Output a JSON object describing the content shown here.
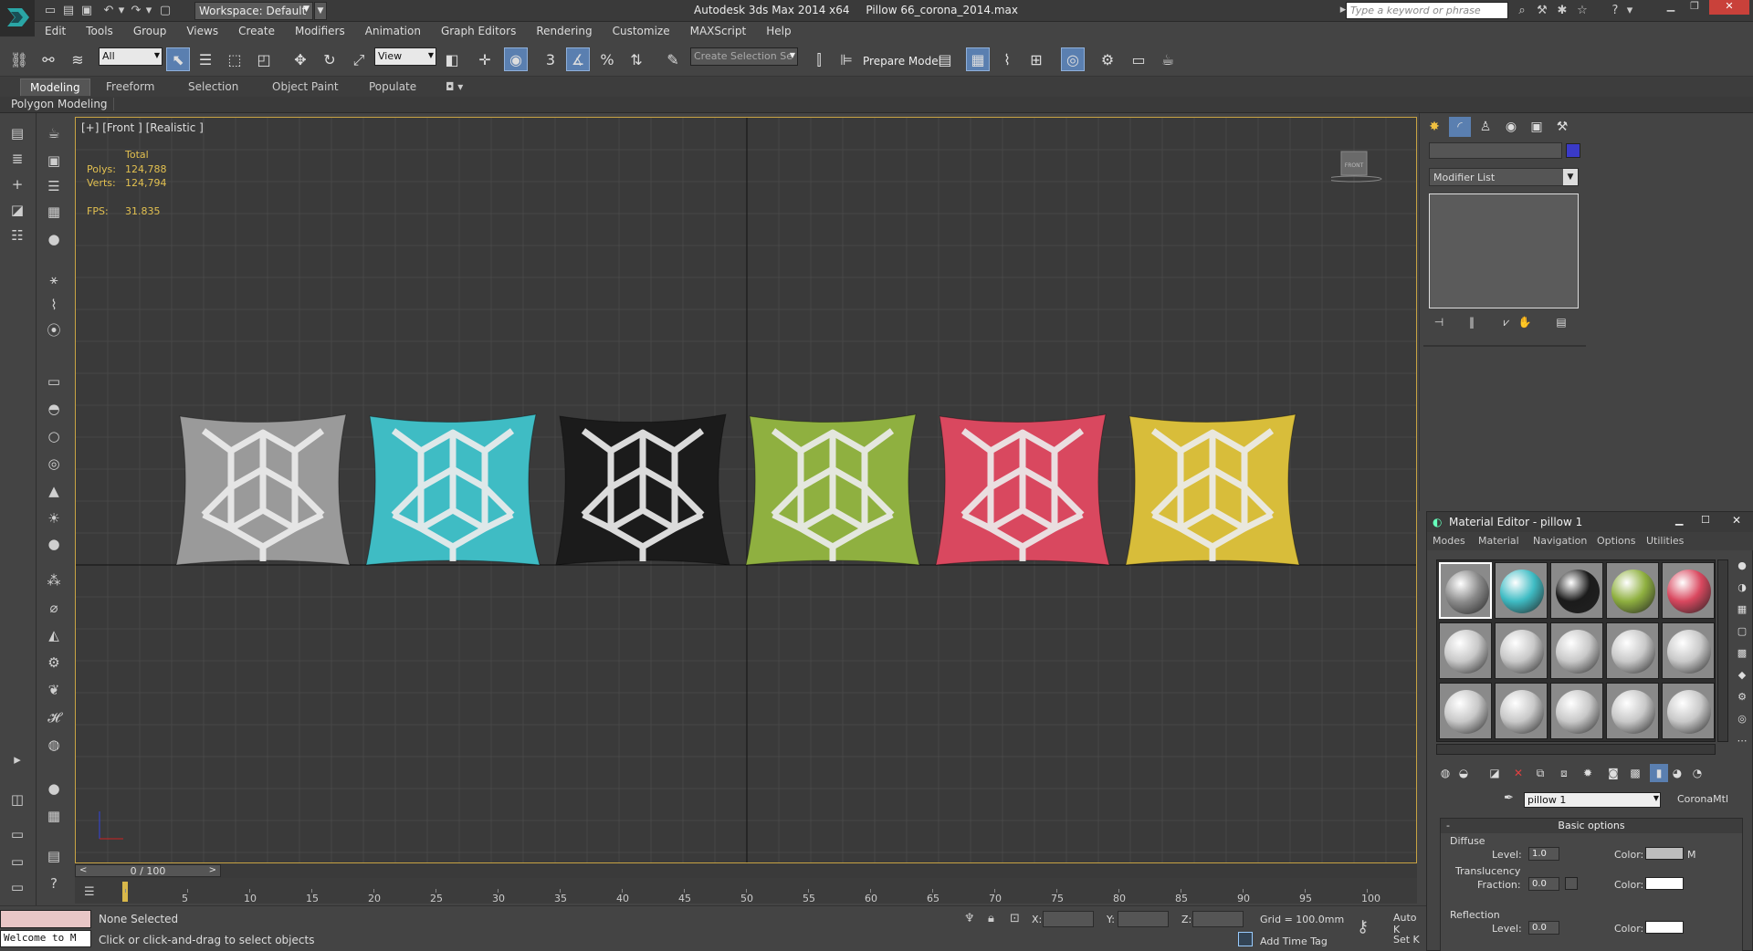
{
  "app": {
    "title": "Autodesk 3ds Max  2014 x64",
    "file": "Pillow 66_corona_2014.max",
    "workspace": "Workspace: Default",
    "search_placeholder": "Type a keyword or phrase"
  },
  "menu": [
    "Edit",
    "Tools",
    "Group",
    "Views",
    "Create",
    "Modifiers",
    "Animation",
    "Graph Editors",
    "Rendering",
    "Customize",
    "MAXScript",
    "Help"
  ],
  "toolbar": {
    "selection_filter": "All",
    "ref_coord": "View",
    "named_selection": "Create Selection Se",
    "prepare_model": "Prepare Model",
    "snap_label": "3"
  },
  "ribbon": {
    "tabs": [
      "Modeling",
      "Freeform",
      "Selection",
      "Object Paint",
      "Populate"
    ],
    "active_tab": "Modeling",
    "panel": "Polygon Modeling"
  },
  "viewport": {
    "label": "[+] [Front ] [Realistic ]",
    "stats": {
      "total_label": "Total",
      "polys_label": "Polys:",
      "polys": "124,788",
      "verts_label": "Verts:",
      "verts": "124,794",
      "fps_label": "FPS:",
      "fps": "31.835"
    },
    "pillows": [
      {
        "name": "pillow-gray",
        "color": "#9a9a9a"
      },
      {
        "name": "pillow-cyan",
        "color": "#3fbcc4"
      },
      {
        "name": "pillow-black",
        "color": "#1b1b1b"
      },
      {
        "name": "pillow-green",
        "color": "#8fb040"
      },
      {
        "name": "pillow-red",
        "color": "#d9485f"
      },
      {
        "name": "pillow-yellow",
        "color": "#d8bd3a"
      }
    ],
    "viewcube_label": "FRONT"
  },
  "command_panel": {
    "modifier_list": "Modifier List",
    "object_color": "#3a3ac8"
  },
  "material_editor": {
    "title": "Material Editor - pillow 1",
    "menu": [
      "Modes",
      "Material",
      "Navigation",
      "Options",
      "Utilities"
    ],
    "material_name": "pillow 1",
    "material_type": "CoronaMtl",
    "slot_colors": [
      "#8a8a8a",
      "#3fbcc4",
      "#1b1b1b",
      "#8fb040",
      "#d9485f",
      "#c8c8c8",
      "#c8c8c8",
      "#c8c8c8",
      "#c8c8c8",
      "#c8c8c8",
      "#c8c8c8",
      "#c8c8c8",
      "#c8c8c8",
      "#c8c8c8",
      "#c8c8c8"
    ],
    "rollout": "Basic options",
    "diffuse": {
      "group": "Diffuse",
      "level_label": "Level:",
      "level": "1.0",
      "color_label": "Color:",
      "map_btn": "M",
      "color": "#bdbdbd"
    },
    "translucency": {
      "group": "Translucency",
      "fraction_label": "Fraction:",
      "fraction": "0.0",
      "color_label": "Color:",
      "color": "#ffffff"
    },
    "reflection": {
      "group": "Reflection",
      "level_label": "Level:",
      "level": "0.0",
      "color_label": "Color:",
      "color": "#ffffff"
    }
  },
  "timeline": {
    "frame": "0 / 100",
    "ticks": [
      "0",
      "5",
      "10",
      "15",
      "20",
      "25",
      "30",
      "35",
      "40",
      "45",
      "50",
      "55",
      "60",
      "65",
      "70",
      "75",
      "80",
      "85",
      "90",
      "95",
      "100"
    ]
  },
  "status": {
    "welcome": "Welcome to M",
    "selection": "None Selected",
    "prompt": "Click or click-and-drag to select objects",
    "x_label": "X:",
    "y_label": "Y:",
    "z_label": "Z:",
    "grid": "Grid = 100.0mm",
    "add_time_tag": "Add Time Tag",
    "auto_key": "Auto K",
    "set_key": "Set K"
  }
}
